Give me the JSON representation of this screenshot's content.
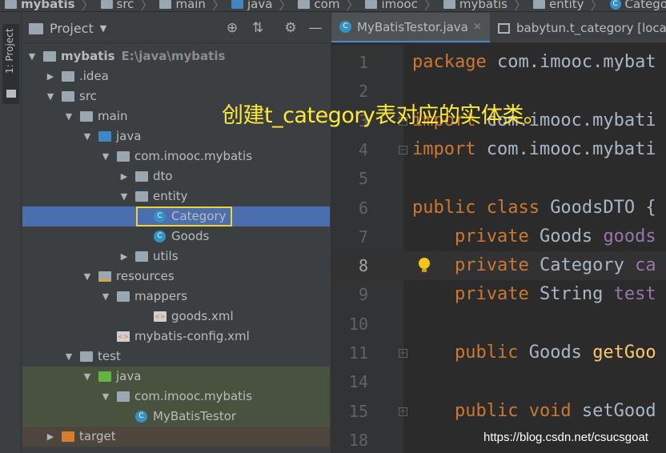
{
  "breadcrumb": [
    {
      "label": "mybatis",
      "icon": "project-folder-icon",
      "bold": true
    },
    {
      "label": "src",
      "icon": "folder-icon"
    },
    {
      "label": "main",
      "icon": "folder-icon"
    },
    {
      "label": "java",
      "icon": "source-folder-icon"
    },
    {
      "label": "com",
      "icon": "package-icon"
    },
    {
      "label": "imooc",
      "icon": "package-icon"
    },
    {
      "label": "mybatis",
      "icon": "package-icon"
    },
    {
      "label": "entity",
      "icon": "package-icon"
    },
    {
      "label": "Category",
      "icon": "class-icon"
    }
  ],
  "tool_window": {
    "label": "1: Project"
  },
  "project_panel": {
    "title": "Project",
    "tree": [
      {
        "label": "mybatis",
        "hint": "E:\\java\\mybatis",
        "depth": 0,
        "arrow": "▼",
        "icon": "project-folder-icon",
        "style": "folder",
        "bold": true
      },
      {
        "label": ".idea",
        "depth": 1,
        "arrow": "▶",
        "icon": "folder-icon",
        "style": "folder"
      },
      {
        "label": "src",
        "depth": 1,
        "arrow": "▼",
        "icon": "folder-icon",
        "style": "folder"
      },
      {
        "label": "main",
        "depth": 2,
        "arrow": "▼",
        "icon": "folder-icon",
        "style": "folder"
      },
      {
        "label": "java",
        "depth": 3,
        "arrow": "▼",
        "icon": "source-folder-icon",
        "style": "blue"
      },
      {
        "label": "com.imooc.mybatis",
        "depth": 4,
        "arrow": "▼",
        "icon": "package-icon",
        "style": "pkg"
      },
      {
        "label": "dto",
        "depth": 5,
        "arrow": "▶",
        "icon": "package-icon",
        "style": "pkg"
      },
      {
        "label": "entity",
        "depth": 5,
        "arrow": "▼",
        "icon": "package-icon",
        "style": "pkg"
      },
      {
        "label": "Category",
        "depth": 6,
        "arrow": "",
        "icon": "class-icon",
        "style": "class",
        "selected": true,
        "boxed": true
      },
      {
        "label": "Goods",
        "depth": 6,
        "arrow": "",
        "icon": "class-icon",
        "style": "class"
      },
      {
        "label": "utils",
        "depth": 5,
        "arrow": "▶",
        "icon": "package-icon",
        "style": "pkg"
      },
      {
        "label": "resources",
        "depth": 3,
        "arrow": "▼",
        "icon": "resources-folder-icon",
        "style": "res"
      },
      {
        "label": "mappers",
        "depth": 4,
        "arrow": "▼",
        "icon": "folder-icon",
        "style": "folder"
      },
      {
        "label": "goods.xml",
        "depth": 6,
        "arrow": "",
        "icon": "xml-file-icon",
        "style": "xml"
      },
      {
        "label": "mybatis-config.xml",
        "depth": 4,
        "arrow": "",
        "icon": "xml-file-icon",
        "style": "xml"
      },
      {
        "label": "test",
        "depth": 2,
        "arrow": "▼",
        "icon": "folder-icon",
        "style": "folder"
      },
      {
        "label": "java",
        "depth": 3,
        "arrow": "▼",
        "icon": "test-source-folder-icon",
        "style": "green",
        "bg": "test"
      },
      {
        "label": "com.imooc.mybatis",
        "depth": 4,
        "arrow": "▼",
        "icon": "package-icon",
        "style": "pkg",
        "bg": "test"
      },
      {
        "label": "MyBatisTestor",
        "depth": 5,
        "arrow": "",
        "icon": "test-class-icon",
        "style": "class",
        "bg": "test"
      },
      {
        "label": "target",
        "depth": 1,
        "arrow": "▶",
        "icon": "excluded-folder-icon",
        "style": "orange",
        "bg": "target"
      }
    ]
  },
  "editor": {
    "tabs": [
      {
        "label": "MyBatisTestor.java",
        "icon": "class-icon",
        "active": true,
        "close": "×"
      },
      {
        "label": "babytun.t_category [local",
        "icon": "table-icon",
        "active": false
      }
    ],
    "lines": [
      {
        "num": "1",
        "tokens": [
          {
            "t": "package ",
            "c": "kw"
          },
          {
            "t": "com.imooc.mybat",
            "c": ""
          }
        ]
      },
      {
        "num": "2",
        "tokens": []
      },
      {
        "num": "3",
        "tokens": [
          {
            "t": "import ",
            "c": "kw"
          },
          {
            "t": "com.imooc.mybati",
            "c": ""
          }
        ],
        "fold": "−"
      },
      {
        "num": "4",
        "tokens": [
          {
            "t": "import ",
            "c": "kw"
          },
          {
            "t": "com.imooc.mybati",
            "c": ""
          }
        ],
        "fold": "−"
      },
      {
        "num": "5",
        "tokens": []
      },
      {
        "num": "6",
        "tokens": [
          {
            "t": "public class ",
            "c": "kw"
          },
          {
            "t": "GoodsDTO {",
            "c": ""
          }
        ]
      },
      {
        "num": "7",
        "tokens": [
          {
            "t": "    private ",
            "c": "kw"
          },
          {
            "t": "Goods ",
            "c": ""
          },
          {
            "t": "goods",
            "c": "fld"
          }
        ]
      },
      {
        "num": "8",
        "tokens": [
          {
            "t": "    private ",
            "c": "kw"
          },
          {
            "t": "Category ",
            "c": ""
          },
          {
            "t": "ca",
            "c": "fld"
          }
        ],
        "current": true,
        "bulb": true
      },
      {
        "num": "9",
        "tokens": [
          {
            "t": "    private ",
            "c": "kw"
          },
          {
            "t": "String ",
            "c": ""
          },
          {
            "t": "test",
            "c": "fld"
          }
        ]
      },
      {
        "num": "10",
        "tokens": []
      },
      {
        "num": "11",
        "tokens": [
          {
            "t": "    public ",
            "c": "kw"
          },
          {
            "t": "Goods ",
            "c": ""
          },
          {
            "t": "getGoo",
            "c": "fn"
          }
        ],
        "fold": "+"
      },
      {
        "num": "14",
        "tokens": []
      },
      {
        "num": "15",
        "tokens": [
          {
            "t": "    public void ",
            "c": "kw"
          },
          {
            "t": "setGood",
            "c": ""
          }
        ],
        "fold": "+"
      },
      {
        "num": "18",
        "tokens": []
      }
    ]
  },
  "annotation": "创建t_category表对应的实体类。",
  "watermark": "https://blog.csdn.net/csucsgoat",
  "colors": {
    "selection": "#4b6eaf",
    "highlight_box": "#f0d22f",
    "annotation": "#ffea35"
  }
}
